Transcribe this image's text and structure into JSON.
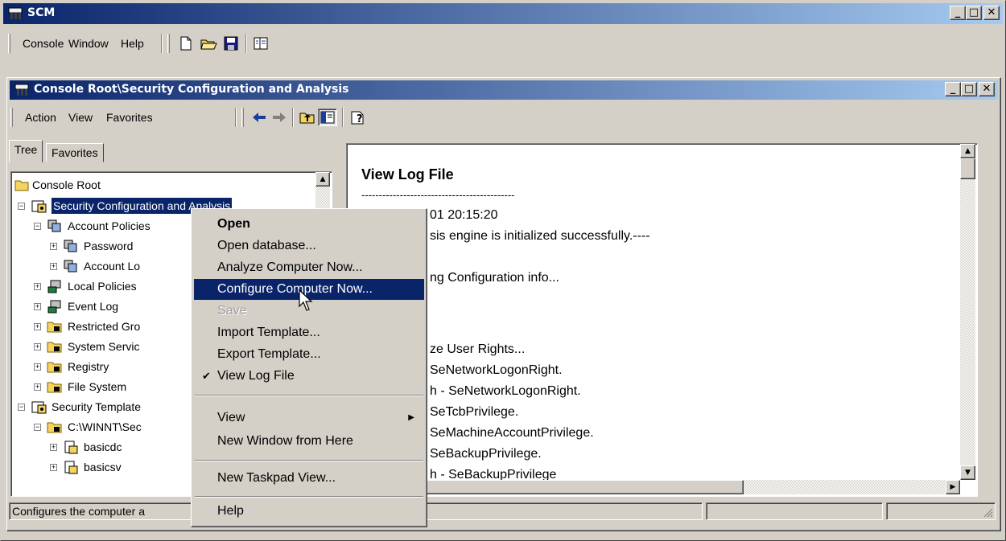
{
  "window": {
    "title": "SCM"
  },
  "menubar": {
    "console": "Console",
    "window": "Window",
    "help": "Help"
  },
  "child": {
    "title": "Console Root\\Security Configuration and Analysis",
    "menu": {
      "action": "Action",
      "view": "View",
      "favorites": "Favorites"
    }
  },
  "tabs": {
    "tree": "Tree",
    "favorites": "Favorites"
  },
  "tree": {
    "root": "Console Root",
    "sca": "Security Configuration and Analysis",
    "account_policies": "Account Policies",
    "password": "Password",
    "account_lockout": "Account Lo",
    "local_policies": "Local Policies",
    "event_log": "Event Log",
    "restricted_groups": "Restricted Gro",
    "system_services": "System Servic",
    "registry": "Registry",
    "file_system": "File System",
    "security_templates": "Security Template",
    "winnt": "C:\\WINNT\\Sec",
    "basicdc": "basicdc",
    "basicsv": "basicsv"
  },
  "log": {
    "heading": "View Log File",
    "dashes": "--------------------------------------------",
    "lines": [
      "01 20:15:20",
      "sis engine is initialized successfully.----",
      "",
      "ng Configuration info...",
      "",
      "",
      "ze User Rights...",
      "SeNetworkLogonRight.",
      "h - SeNetworkLogonRight.",
      "SeTcbPrivilege.",
      "SeMachineAccountPrivilege.",
      "SeBackupPrivilege.",
      "h - SeBackupPrivilege"
    ]
  },
  "status": {
    "text": "Configures the computer a"
  },
  "context_menu": {
    "items": [
      "Open",
      "Open database...",
      "Analyze Computer Now...",
      "Configure Computer Now...",
      "Save",
      "Import Template...",
      "Export Template...",
      "View Log File",
      "View",
      "New Window from Here",
      "New Taskpad View...",
      "Help"
    ]
  },
  "colors": {
    "title_start": "#0a246a",
    "title_end": "#a6caf0",
    "highlight": "#0a246a",
    "face": "#d4d0c8"
  }
}
